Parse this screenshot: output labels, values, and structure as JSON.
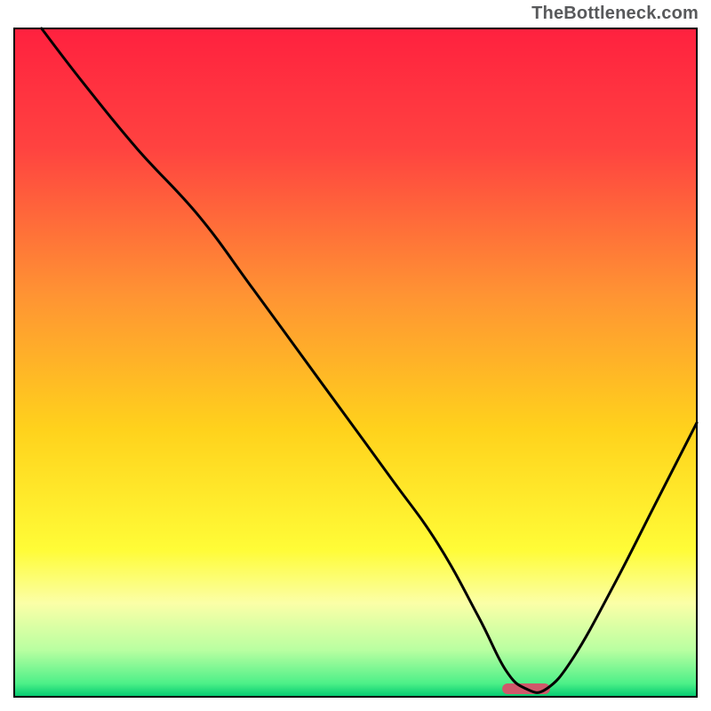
{
  "watermark": "TheBottleneck.com",
  "chart_data": {
    "type": "line",
    "title": "",
    "xlabel": "",
    "ylabel": "",
    "xlim": [
      0,
      100
    ],
    "ylim": [
      0,
      100
    ],
    "grid": false,
    "legend": false,
    "background_gradient": {
      "stops": [
        {
          "offset": 0.0,
          "color": "#ff213f"
        },
        {
          "offset": 0.18,
          "color": "#ff4340"
        },
        {
          "offset": 0.4,
          "color": "#ff9433"
        },
        {
          "offset": 0.6,
          "color": "#ffd21c"
        },
        {
          "offset": 0.78,
          "color": "#fffc37"
        },
        {
          "offset": 0.86,
          "color": "#fbffa7"
        },
        {
          "offset": 0.93,
          "color": "#b9ffa1"
        },
        {
          "offset": 0.98,
          "color": "#4df088"
        },
        {
          "offset": 1.0,
          "color": "#00c86f"
        }
      ]
    },
    "annotations": [
      {
        "type": "bar-segment",
        "x0": 71.5,
        "x1": 78.5,
        "y": 1.2,
        "color": "#d0586a"
      }
    ],
    "series": [
      {
        "name": "bottleneck-curve",
        "color": "#000000",
        "x": [
          4.0,
          10.0,
          18.0,
          27.0,
          35.0,
          45.0,
          55.0,
          62.0,
          68.0,
          72.0,
          75.0,
          78.0,
          82.0,
          88.0,
          94.0,
          100.0
        ],
        "values": [
          100.0,
          92.0,
          82.0,
          72.0,
          61.0,
          47.0,
          33.0,
          23.0,
          12.0,
          4.0,
          1.2,
          1.2,
          6.0,
          17.0,
          29.0,
          41.0
        ]
      }
    ]
  }
}
